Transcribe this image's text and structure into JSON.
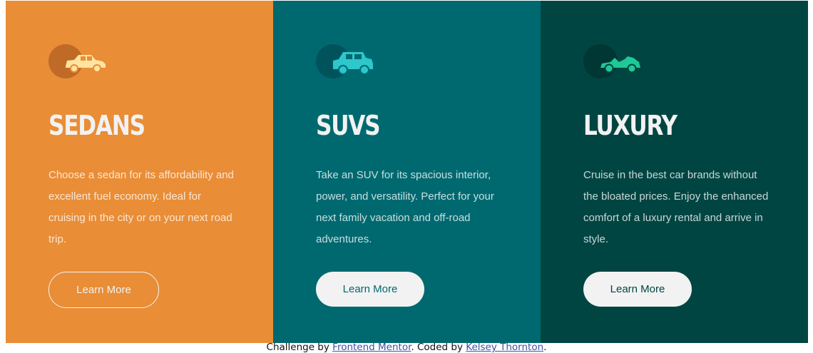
{
  "cards": [
    {
      "icon": "sedan-car-icon",
      "title": "SEDANS",
      "text": "Choose a sedan for its affordability and excellent fuel economy. Ideal for cruising in the city or on your next road trip.",
      "button": "Learn More",
      "bg_color": "#e98d36"
    },
    {
      "icon": "suv-car-icon",
      "title": "SUVS",
      "text": "Take an SUV for its spacious interior, power, and versatility. Perfect for your next family vacation and off-road adventures.",
      "button": "Learn More",
      "bg_color": "#006970"
    },
    {
      "icon": "luxury-car-icon",
      "title": "LUXURY",
      "text": "Cruise in the best car brands without the bloated prices. Enjoy the enhanced comfort of a luxury rental and arrive in style.",
      "button": "Learn More",
      "bg_color": "#004542"
    }
  ],
  "footer": {
    "prefix": "Challenge by ",
    "link1": "Frontend Mentor",
    "middle": ". Coded by ",
    "link2": "Kelsey Thornton",
    "suffix": "."
  }
}
